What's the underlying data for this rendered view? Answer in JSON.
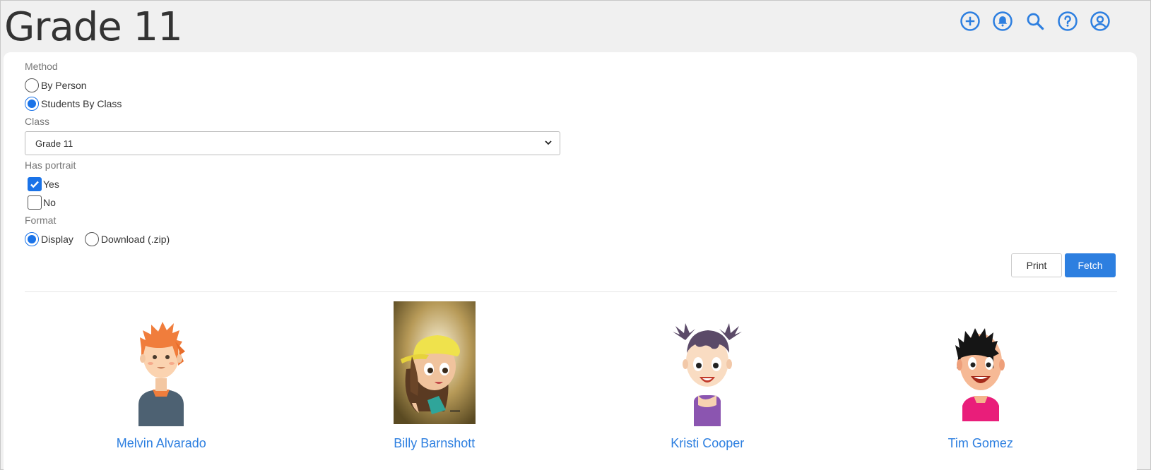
{
  "page": {
    "title": "Grade 11"
  },
  "top_icons": [
    "add-circle-icon",
    "bell-icon",
    "search-icon",
    "help-icon",
    "account-icon"
  ],
  "form": {
    "method_label": "Method",
    "method_options": [
      {
        "label": "By Person",
        "checked": false
      },
      {
        "label": "Students By Class",
        "checked": true
      }
    ],
    "class_label": "Class",
    "class_value": "Grade 11",
    "portrait_label": "Has portrait",
    "portrait_options": [
      {
        "label": "Yes",
        "checked": true
      },
      {
        "label": "No",
        "checked": false
      }
    ],
    "format_label": "Format",
    "format_options": [
      {
        "label": "Display",
        "checked": true
      },
      {
        "label": "Download (.zip)",
        "checked": false
      }
    ]
  },
  "buttons": {
    "print": "Print",
    "fetch": "Fetch"
  },
  "colors": {
    "accent": "#2d7fe0"
  },
  "students": [
    {
      "name": "Melvin Alvarado"
    },
    {
      "name": "Billy Barnshott"
    },
    {
      "name": "Kristi Cooper"
    },
    {
      "name": "Tim Gomez"
    }
  ]
}
